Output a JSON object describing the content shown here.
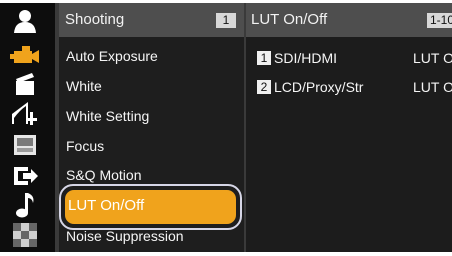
{
  "sidebar": {
    "icons": [
      "user-icon",
      "camera-icon",
      "clapperboard-icon",
      "curve-edit-icon",
      "timecode-icon",
      "output-icon",
      "music-note-icon",
      "checker-icon"
    ]
  },
  "menu": {
    "title": "Shooting",
    "page": "1",
    "items": [
      {
        "label": "Auto Exposure"
      },
      {
        "label": "White"
      },
      {
        "label": "White Setting"
      },
      {
        "label": "Focus"
      },
      {
        "label": "S&Q Motion"
      },
      {
        "label": "LUT On/Off"
      },
      {
        "label": "Noise Suppression"
      }
    ],
    "selected": "LUT On/Off"
  },
  "submenu": {
    "title": "LUT On/Off",
    "page": "1-10",
    "rows": [
      {
        "num": "1",
        "label": "SDI/HDMI",
        "value": "LUT On"
      },
      {
        "num": "2",
        "label": "LCD/Proxy/Str",
        "value": "LUT On"
      }
    ]
  },
  "colors": {
    "accent": "#f0a31c",
    "header": "#4e4e4e",
    "background": "#1c1c1c"
  }
}
